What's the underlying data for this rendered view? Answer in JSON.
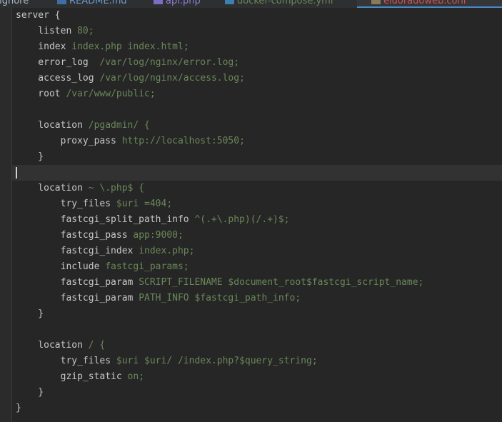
{
  "tabs": [
    {
      "label": "tignore",
      "color": "#a9b7c6"
    },
    {
      "label": "README.md",
      "color": "#6a9bd0",
      "icon": "markdown-file-icon",
      "iconColor": "#3d6fa6"
    },
    {
      "label": "api.php",
      "color": "#8c7ed9",
      "icon": "php-file-icon",
      "iconColor": "#7b6cc4"
    },
    {
      "label": "docker-compose.yml",
      "color": "#6a8759",
      "icon": "docker-compose-file-icon",
      "iconColor": "#3d7fb0"
    },
    {
      "label": "eldoradoweb.conf",
      "color": "#d25252",
      "icon": "config-file-icon",
      "iconColor": "#8a7a5a",
      "active": true
    }
  ],
  "code": [
    [
      [
        "server {",
        ""
      ]
    ],
    [
      [
        "    listen ",
        ""
      ],
      [
        "80;",
        "v"
      ]
    ],
    [
      [
        "    index ",
        ""
      ],
      [
        "index.php index.html;",
        "v"
      ]
    ],
    [
      [
        "    error_log  ",
        ""
      ],
      [
        "/var/log/nginx/error.log;",
        "v"
      ]
    ],
    [
      [
        "    access_log ",
        ""
      ],
      [
        "/var/log/nginx/access.log;",
        "v"
      ]
    ],
    [
      [
        "    root ",
        ""
      ],
      [
        "/var/www/public;",
        "v"
      ]
    ],
    [
      [
        "",
        ""
      ]
    ],
    [
      [
        "    location ",
        ""
      ],
      [
        "/pgadmin/ {",
        "v"
      ]
    ],
    [
      [
        "        proxy_pass ",
        ""
      ],
      [
        "http://localhost:5050;",
        "v"
      ]
    ],
    [
      [
        "    }",
        ""
      ]
    ],
    [
      [
        "",
        ""
      ]
    ],
    [
      [
        "    location ",
        ""
      ],
      [
        "~ \\.php$ {",
        "v"
      ]
    ],
    [
      [
        "        try_files ",
        ""
      ],
      [
        "$uri =404;",
        "v"
      ]
    ],
    [
      [
        "        fastcgi_split_path_info ",
        ""
      ],
      [
        "^(.+\\.php)(/.+)$;",
        "v"
      ]
    ],
    [
      [
        "        fastcgi_pass ",
        ""
      ],
      [
        "app:9000;",
        "v"
      ]
    ],
    [
      [
        "        fastcgi_index ",
        ""
      ],
      [
        "index.php;",
        "v"
      ]
    ],
    [
      [
        "        include ",
        ""
      ],
      [
        "fastcgi_params;",
        "v"
      ]
    ],
    [
      [
        "        fastcgi_param ",
        ""
      ],
      [
        "SCRIPT_FILENAME $document_root$fastcgi_script_name;",
        "v"
      ]
    ],
    [
      [
        "        fastcgi_param ",
        ""
      ],
      [
        "PATH_INFO $fastcgi_path_info;",
        "v"
      ]
    ],
    [
      [
        "    }",
        ""
      ]
    ],
    [
      [
        "",
        ""
      ]
    ],
    [
      [
        "    location ",
        ""
      ],
      [
        "/ {",
        "v"
      ]
    ],
    [
      [
        "        try_files ",
        ""
      ],
      [
        "$uri $uri/ /index.php?$query_string;",
        "v"
      ]
    ],
    [
      [
        "        gzip_static ",
        ""
      ],
      [
        "on;",
        "v"
      ]
    ],
    [
      [
        "    }",
        ""
      ]
    ],
    [
      [
        "}",
        ""
      ]
    ]
  ],
  "current_line": 10
}
